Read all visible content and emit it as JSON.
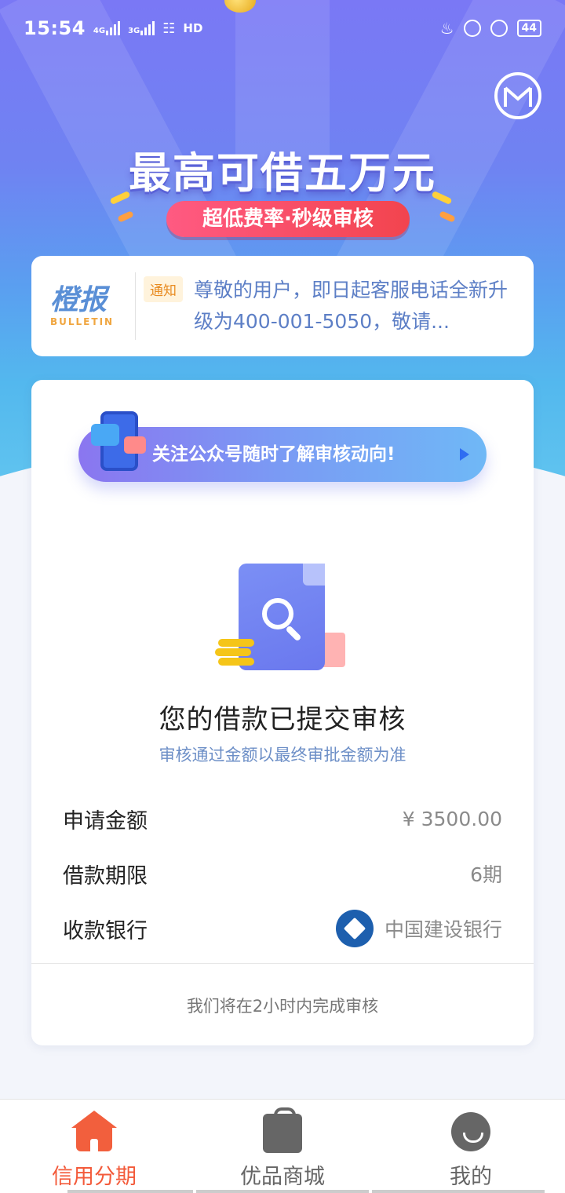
{
  "status_bar": {
    "time": "15:54",
    "network_1": "4G",
    "network_2": "3G",
    "hd_label": "HD",
    "battery": "44"
  },
  "hero": {
    "title": "最高可借五万元",
    "pill": "超低费率·秒级审核"
  },
  "bulletin": {
    "logo_cn": "橙报",
    "logo_en": "BULLETIN",
    "tag": "通知",
    "text": "尊敬的用户，即日起客服电话全新升级为400-001-5050，敬请..."
  },
  "follow_banner": {
    "text": "关注公众号随时了解审核动向!"
  },
  "review": {
    "title": "您的借款已提交审核",
    "subtitle": "审核通过金额以最终审批金额为准"
  },
  "details": [
    {
      "label": "申请金额",
      "value": "¥ 3500.00"
    },
    {
      "label": "借款期限",
      "value": "6期"
    },
    {
      "label": "收款银行",
      "value": "中国建设银行",
      "icon": "ccb-bank-icon"
    }
  ],
  "footer_note": "我们将在2小时内完成审核",
  "bottom_nav": [
    {
      "label": "信用分期",
      "icon": "home-icon",
      "active": true
    },
    {
      "label": "优品商城",
      "icon": "shopping-bag-icon",
      "active": false
    },
    {
      "label": "我的",
      "icon": "profile-icon",
      "active": false
    }
  ],
  "colors": {
    "accent": "#f35a3a",
    "hero_top": "#7a78f5",
    "hero_bottom": "#5fc3ef",
    "pill": "#f2444e",
    "link_blue": "#6d8fc7"
  }
}
